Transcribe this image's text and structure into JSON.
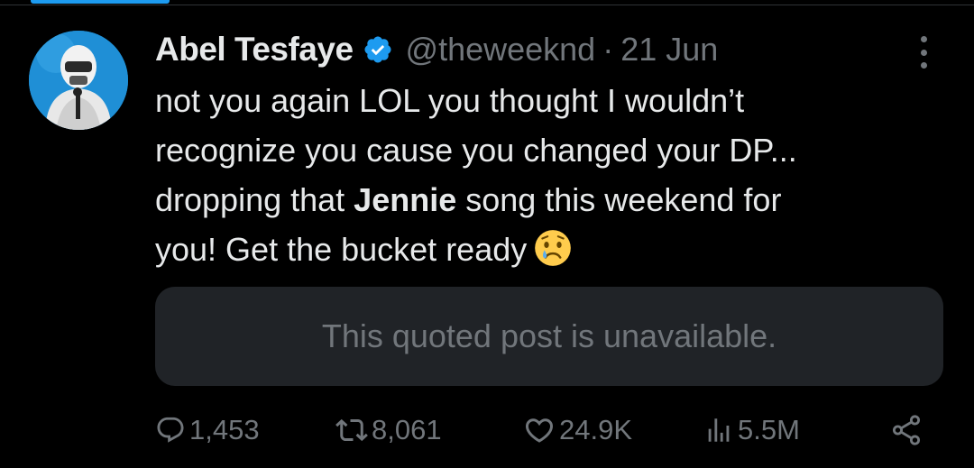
{
  "tweet": {
    "author_name": "Abel Tesfaye",
    "handle": "@theweeknd",
    "separator": "·",
    "time": "21 Jun",
    "text_line1": "not you again LOL you thought I wouldn’t",
    "text_line2": "recognize you cause you changed your DP...",
    "text_line3_before": "dropping that ",
    "text_line3_bold": "Jennie",
    "text_line3_after": " song this weekend for",
    "text_line4": "you! Get the bucket ready",
    "emoji": "crying-face-icon",
    "quoted_post": "This quoted post is unavailable."
  },
  "actions": {
    "replies": "1,453",
    "reposts": "8,061",
    "likes": "24.9K",
    "views": "5.5M"
  },
  "colors": {
    "background": "#000000",
    "text_primary": "#e7e9ea",
    "text_secondary": "#71767b",
    "verified_blue": "#1d9bf0",
    "quote_bg": "#202327"
  },
  "icons": {
    "verified": "verified-badge-icon",
    "more": "more-options-icon",
    "reply": "reply-icon",
    "repost": "repost-icon",
    "like": "heart-icon",
    "views": "views-icon",
    "share": "share-icon"
  }
}
